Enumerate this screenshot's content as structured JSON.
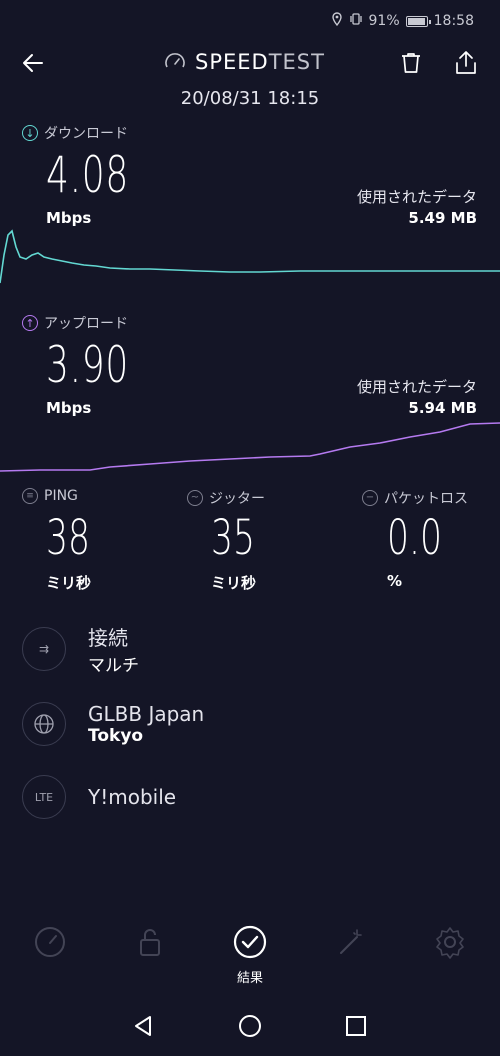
{
  "status_bar": {
    "battery_percent": "91%",
    "time": "18:58",
    "icons": [
      "location-icon",
      "vibrate-icon",
      "battery-icon"
    ]
  },
  "header": {
    "title_bold": "SPEED",
    "title_rest": "TEST",
    "timestamp": "20/08/31 18:15"
  },
  "download": {
    "label": "ダウンロード",
    "value": "4.08",
    "unit": "Mbps",
    "data_used_label": "使用されたデータ",
    "data_used_value": "5.49 MB",
    "color": "#63d8d2"
  },
  "upload": {
    "label": "アップロード",
    "value": "3.90",
    "unit": "Mbps",
    "data_used_label": "使用されたデータ",
    "data_used_value": "5.94 MB",
    "color": "#b57af0"
  },
  "metrics": {
    "ping": {
      "label": "PING",
      "value": "38",
      "unit": "ミリ秒"
    },
    "jitter": {
      "label": "ジッター",
      "value": "35",
      "unit": "ミリ秒"
    },
    "packet_loss": {
      "label": "パケットロス",
      "value": "0.0",
      "unit": "%"
    }
  },
  "info": {
    "connection": {
      "title": "接続",
      "value": "マルチ"
    },
    "server": {
      "title": "GLBB Japan",
      "value": "Tokyo"
    },
    "provider": {
      "badge": "LTE",
      "title": "Y!mobile"
    }
  },
  "bottom_nav": {
    "active_label": "結果",
    "items": [
      "speed-icon",
      "vpn-lock-icon",
      "results-check-icon",
      "magic-wand-icon",
      "settings-gear-icon"
    ]
  },
  "accent": {
    "background": "#141526",
    "download": "#63d8d2",
    "upload": "#b57af0"
  }
}
